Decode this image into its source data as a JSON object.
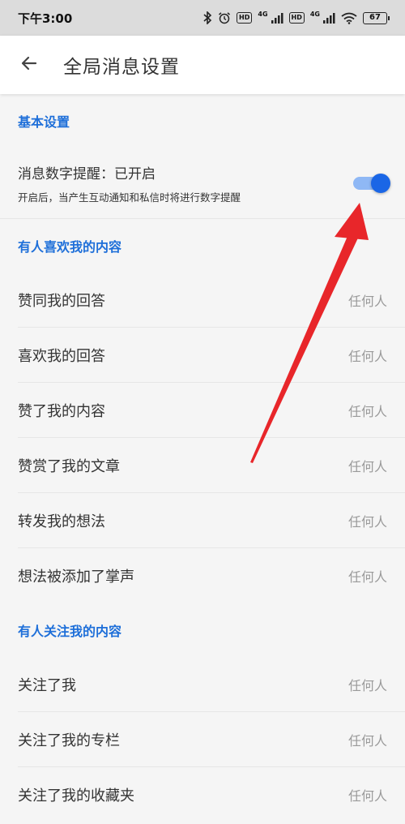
{
  "status_bar": {
    "time": "下午3:00",
    "hd_badge_1": "HD",
    "hd_badge_2": "HD",
    "network_1": "4G",
    "network_2": "4G",
    "battery": "67",
    "icons": [
      "bluetooth-icon",
      "alarm-icon",
      "signal-icon",
      "wifi-icon",
      "battery-icon"
    ]
  },
  "app_bar": {
    "back_icon": "arrow-left-icon",
    "title": "全局消息设置"
  },
  "sections": {
    "basic": {
      "header": "基本设置",
      "switch": {
        "title": "消息数字提醒：已开启",
        "description": "开启后，当产生互动通知和私信时将进行数字提醒",
        "on": true
      }
    },
    "likes": {
      "header": "有人喜欢我的内容",
      "items": [
        {
          "label": "赞同我的回答",
          "value": "任何人"
        },
        {
          "label": "喜欢我的回答",
          "value": "任何人"
        },
        {
          "label": "赞了我的内容",
          "value": "任何人"
        },
        {
          "label": "赞赏了我的文章",
          "value": "任何人"
        },
        {
          "label": "转发我的想法",
          "value": "任何人"
        },
        {
          "label": "想法被添加了掌声",
          "value": "任何人"
        }
      ]
    },
    "follows": {
      "header": "有人关注我的内容",
      "items": [
        {
          "label": "关注了我",
          "value": "任何人"
        },
        {
          "label": "关注了我的专栏",
          "value": "任何人"
        },
        {
          "label": "关注了我的收藏夹",
          "value": "任何人"
        }
      ]
    }
  },
  "colors": {
    "accent": "#1e6fd9",
    "toggle_on": "#1a66e6",
    "annotation_arrow": "#e8262a"
  }
}
